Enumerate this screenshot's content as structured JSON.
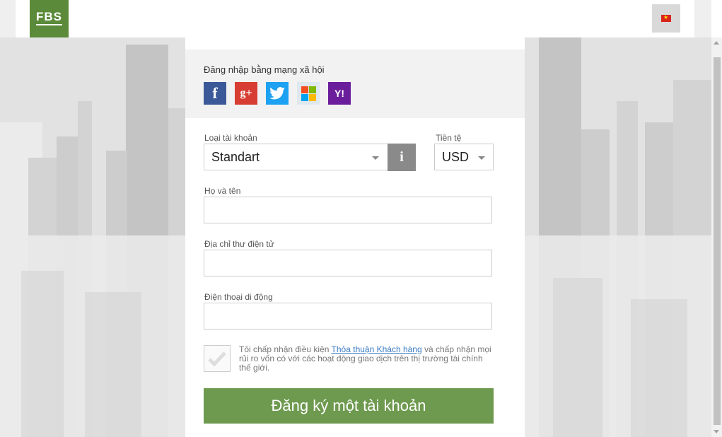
{
  "header": {
    "logo_text": "FBS",
    "language_flag": "vn-flag-icon"
  },
  "social": {
    "title": "Đăng nhập bằng mạng xã hội",
    "icons": [
      "facebook-icon",
      "google-plus-icon",
      "twitter-icon",
      "microsoft-icon",
      "yahoo-icon"
    ],
    "fb_glyph": "f",
    "gp_glyph": "g+",
    "yh_glyph": "Y!"
  },
  "form": {
    "account_type_label": "Loại tài khoản",
    "account_type_value": "Standart",
    "info_glyph": "i",
    "currency_label": "Tiền tệ",
    "currency_value": "USD",
    "fullname_label": "Họ và tên",
    "fullname_value": "",
    "email_label": "Địa chỉ thư điện tử",
    "email_value": "",
    "phone_label": "Điện thoại di động",
    "phone_value": "",
    "terms_prefix": "Tôi chấp nhận điều kiện ",
    "terms_link": "Thỏa thuận Khách hàng",
    "terms_suffix": " và chấp nhận mọi rủi ro vốn có với các hoạt động giao dịch trên thị trường tài chính thế giới.",
    "submit_label": "Đăng ký một tài khoản"
  },
  "colors": {
    "brand_green": "#5b8b3a",
    "button_green": "#6e9a4f",
    "link_blue": "#3b7dc4"
  }
}
